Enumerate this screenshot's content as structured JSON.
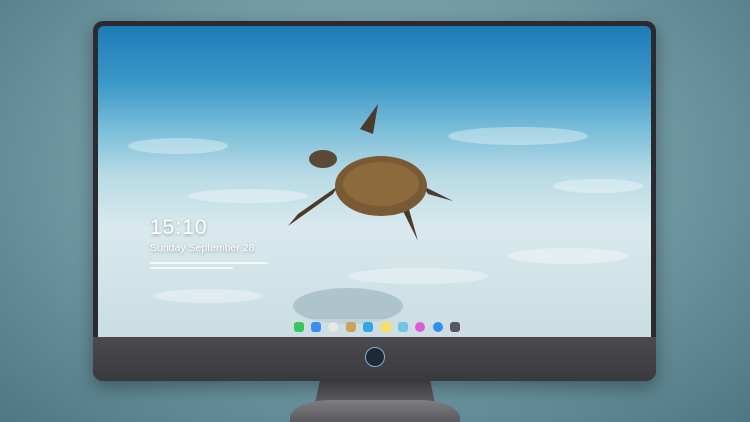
{
  "lock_screen": {
    "time": "15:10",
    "date": "Sunday September 28"
  },
  "dock": {
    "apps": [
      {
        "icon": "messages-icon",
        "color": "#34c759"
      },
      {
        "icon": "finder-icon",
        "color": "#3b8df5"
      },
      {
        "icon": "safari-icon",
        "color": "#e8e8e8"
      },
      {
        "icon": "preview-icon",
        "color": "#c9a45a"
      },
      {
        "icon": "claquette-icon",
        "color": "#2fa9e6"
      },
      {
        "icon": "notes-icon",
        "color": "#f7e05a"
      },
      {
        "icon": "photos-icon",
        "color": "#6fc5e8"
      },
      {
        "icon": "itunes-icon",
        "color": "#e05ad8"
      },
      {
        "icon": "app-store-icon",
        "color": "#2f8ff0"
      },
      {
        "icon": "camera-icon",
        "color": "#555a60"
      }
    ]
  }
}
